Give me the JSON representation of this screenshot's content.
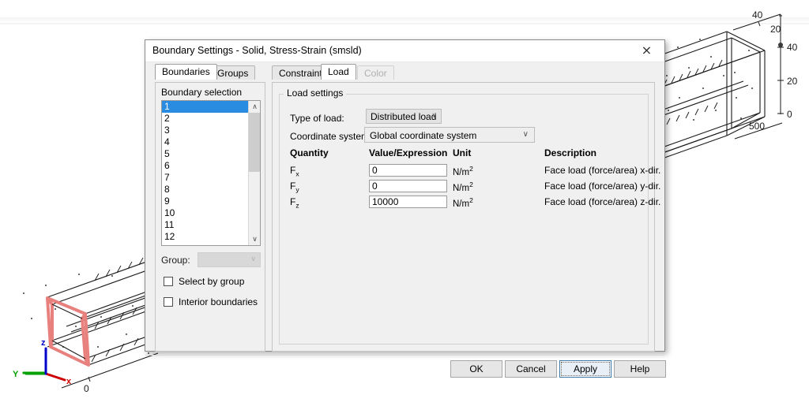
{
  "viewport": {
    "name": "comsol-3d-geometry-view",
    "axis_triad": {
      "x_label": "x",
      "y_label": "Y",
      "z_label": "z",
      "x_color": "#cc0000",
      "y_color": "#00a000",
      "z_color": "#0000cc"
    },
    "selected_face_color": "#e8817e",
    "near_origin_label": "0",
    "far_axis_labels": [
      "40",
      "20",
      "40",
      "20",
      "0",
      "500"
    ]
  },
  "dialog": {
    "title": "Boundary Settings - Solid, Stress-Strain (smsld)",
    "close_icon": "×",
    "left_tabs": [
      {
        "label": "Boundaries",
        "active": true,
        "disabled": false
      },
      {
        "label": "Groups",
        "active": false,
        "disabled": false
      }
    ],
    "right_tabs": [
      {
        "label": "Constraint",
        "active": false,
        "disabled": false
      },
      {
        "label": "Load",
        "active": true,
        "disabled": false
      },
      {
        "label": "Color",
        "active": false,
        "disabled": true
      }
    ],
    "boundary_selection": {
      "label": "Boundary selection",
      "items": [
        "1",
        "2",
        "3",
        "4",
        "5",
        "6",
        "7",
        "8",
        "9",
        "10",
        "11",
        "12"
      ],
      "selected": "1",
      "selected_color": "#2a8ce0",
      "scroll_up_icon": "∧",
      "scroll_down_icon": "∨"
    },
    "group_row": {
      "label": "Group:",
      "value": "",
      "disabled": true,
      "chevron_icon": "∨"
    },
    "checkboxes": [
      {
        "label": "Select by group",
        "checked": false
      },
      {
        "label": "Interior boundaries",
        "checked": false
      }
    ],
    "load_settings": {
      "title": "Load settings",
      "type_of_load": {
        "label": "Type of load:",
        "value": "Distributed load",
        "chevron_icon": "∨"
      },
      "coordinate_system": {
        "label": "Coordinate system:",
        "value": "Global coordinate system",
        "chevron_icon": "∨"
      },
      "table": {
        "headers": [
          "Quantity",
          "Value/Expression",
          "Unit",
          "Description"
        ],
        "rows": [
          {
            "quantity_base": "F",
            "quantity_sub": "x",
            "value": "0",
            "unit_base": "N/m",
            "unit_sup": "2",
            "description": "Face load (force/area) x-dir."
          },
          {
            "quantity_base": "F",
            "quantity_sub": "y",
            "value": "0",
            "unit_base": "N/m",
            "unit_sup": "2",
            "description": "Face load (force/area) y-dir."
          },
          {
            "quantity_base": "F",
            "quantity_sub": "z",
            "value": "10000",
            "unit_base": "N/m",
            "unit_sup": "2",
            "description": "Face load (force/area) z-dir."
          }
        ]
      }
    },
    "buttons": [
      {
        "label": "OK",
        "focused": false
      },
      {
        "label": "Cancel",
        "focused": false
      },
      {
        "label": "Apply",
        "focused": true
      },
      {
        "label": "Help",
        "focused": false
      }
    ]
  }
}
